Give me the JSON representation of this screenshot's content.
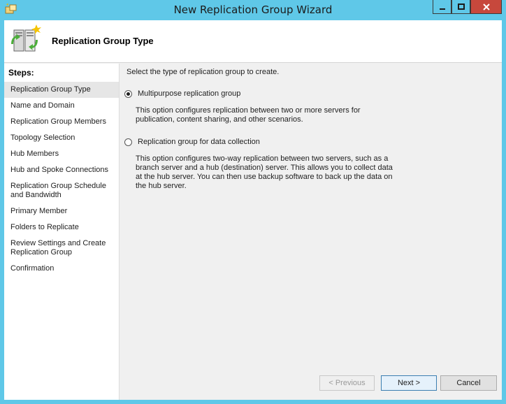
{
  "window": {
    "title": "New Replication Group Wizard"
  },
  "header": {
    "title": "Replication Group Type"
  },
  "steps": {
    "heading": "Steps:",
    "items": [
      "Replication Group Type",
      "Name and Domain",
      "Replication Group Members",
      "Topology Selection",
      "Hub Members",
      "Hub and Spoke Connections",
      "Replication Group Schedule and Bandwidth",
      "Primary Member",
      "Folders to Replicate",
      "Review Settings and Create Replication Group",
      "Confirmation"
    ]
  },
  "main": {
    "prompt": "Select the type of replication group to create.",
    "options": [
      {
        "label": "Multipurpose replication group",
        "selected": true,
        "description": "This option configures replication between two or more servers for publication, content sharing, and other scenarios."
      },
      {
        "label": "Replication group for data collection",
        "selected": false,
        "description": "This option configures two-way replication between two servers, such as a branch server and a hub (destination) server. This allows you to collect data at the hub server. You can then use backup software to back up the data on the hub server."
      }
    ]
  },
  "buttons": {
    "previous": "< Previous",
    "next": "Next >",
    "cancel": "Cancel"
  }
}
